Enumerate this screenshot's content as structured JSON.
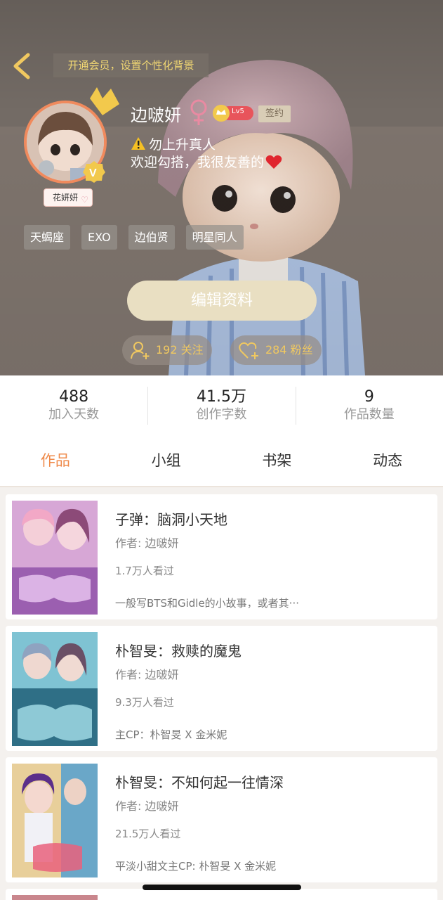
{
  "header": {
    "vip_banner": "开通会员，设置个性化背景"
  },
  "profile": {
    "username": "边啵妍",
    "level": "Lv5",
    "sign_badge": "签约",
    "avatar_tag": "花妍妍",
    "bio_line1": "勿上升真人",
    "bio_line2": "欢迎勾搭，我很友善的",
    "tags": [
      "天蝎座",
      "EXO",
      "边伯贤",
      "明星同人"
    ],
    "edit_button": "编辑资料",
    "follow_label": "192 关注",
    "fans_label": "284 粉丝"
  },
  "stats": [
    {
      "value": "488",
      "label": "加入天数"
    },
    {
      "value": "41.5万",
      "label": "创作字数"
    },
    {
      "value": "9",
      "label": "作品数量"
    }
  ],
  "tabs": [
    "作品",
    "小组",
    "书架",
    "动态"
  ],
  "active_tab": "作品",
  "books": [
    {
      "title": "子弹：脑洞小天地",
      "author": "作者: 边啵妍",
      "views": "1.7万人看过",
      "desc": "一般写BTS和Gidle的小故事，或者其···"
    },
    {
      "title": "朴智旻：救赎的魔鬼",
      "author": "作者: 边啵妍",
      "views": "9.3万人看过",
      "desc": "主CP：朴智旻 X 金米妮"
    },
    {
      "title": "朴智旻：不知何起一往情深",
      "author": "作者: 边啵妍",
      "views": "21.5万人看过",
      "desc": "平淡小甜文主CP: 朴智旻 X 金米妮"
    }
  ],
  "colors": {
    "accent": "#ef8a4a",
    "gold": "#f0c860",
    "edit_button_bg": "#e9dfc2"
  }
}
